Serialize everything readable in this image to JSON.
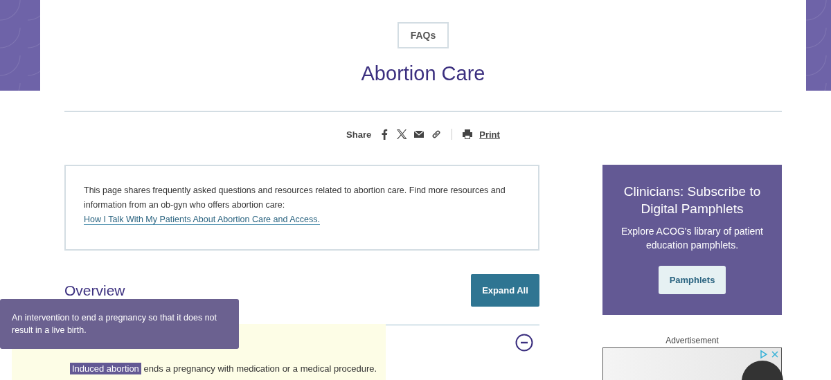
{
  "header": {
    "badge": "FAQs",
    "title": "Abortion Care"
  },
  "share": {
    "label": "Share",
    "print": "Print"
  },
  "intro": {
    "text": "This page shares frequently asked questions and resources related to abortion care. Find more resources and information from an ob-gyn who offers abortion care: ",
    "link": "How I Talk With My Patients About Abortion Care and Access."
  },
  "overview": {
    "heading": "Overview",
    "button": "Expand All",
    "expanded": true,
    "answer": {
      "term": "Induced abortion",
      "text": " ends a pregnancy with medication or a medical procedure."
    }
  },
  "tooltip": {
    "text": "An intervention to end a pregnancy so that it does not result in a live birth."
  },
  "promo": {
    "title": "Clinicians: Subscribe to Digital Pamphlets",
    "text": "Explore ACOG's library of patient education pamphlets.",
    "button": "Pamphlets"
  },
  "ad": {
    "label": "Advertisement"
  }
}
